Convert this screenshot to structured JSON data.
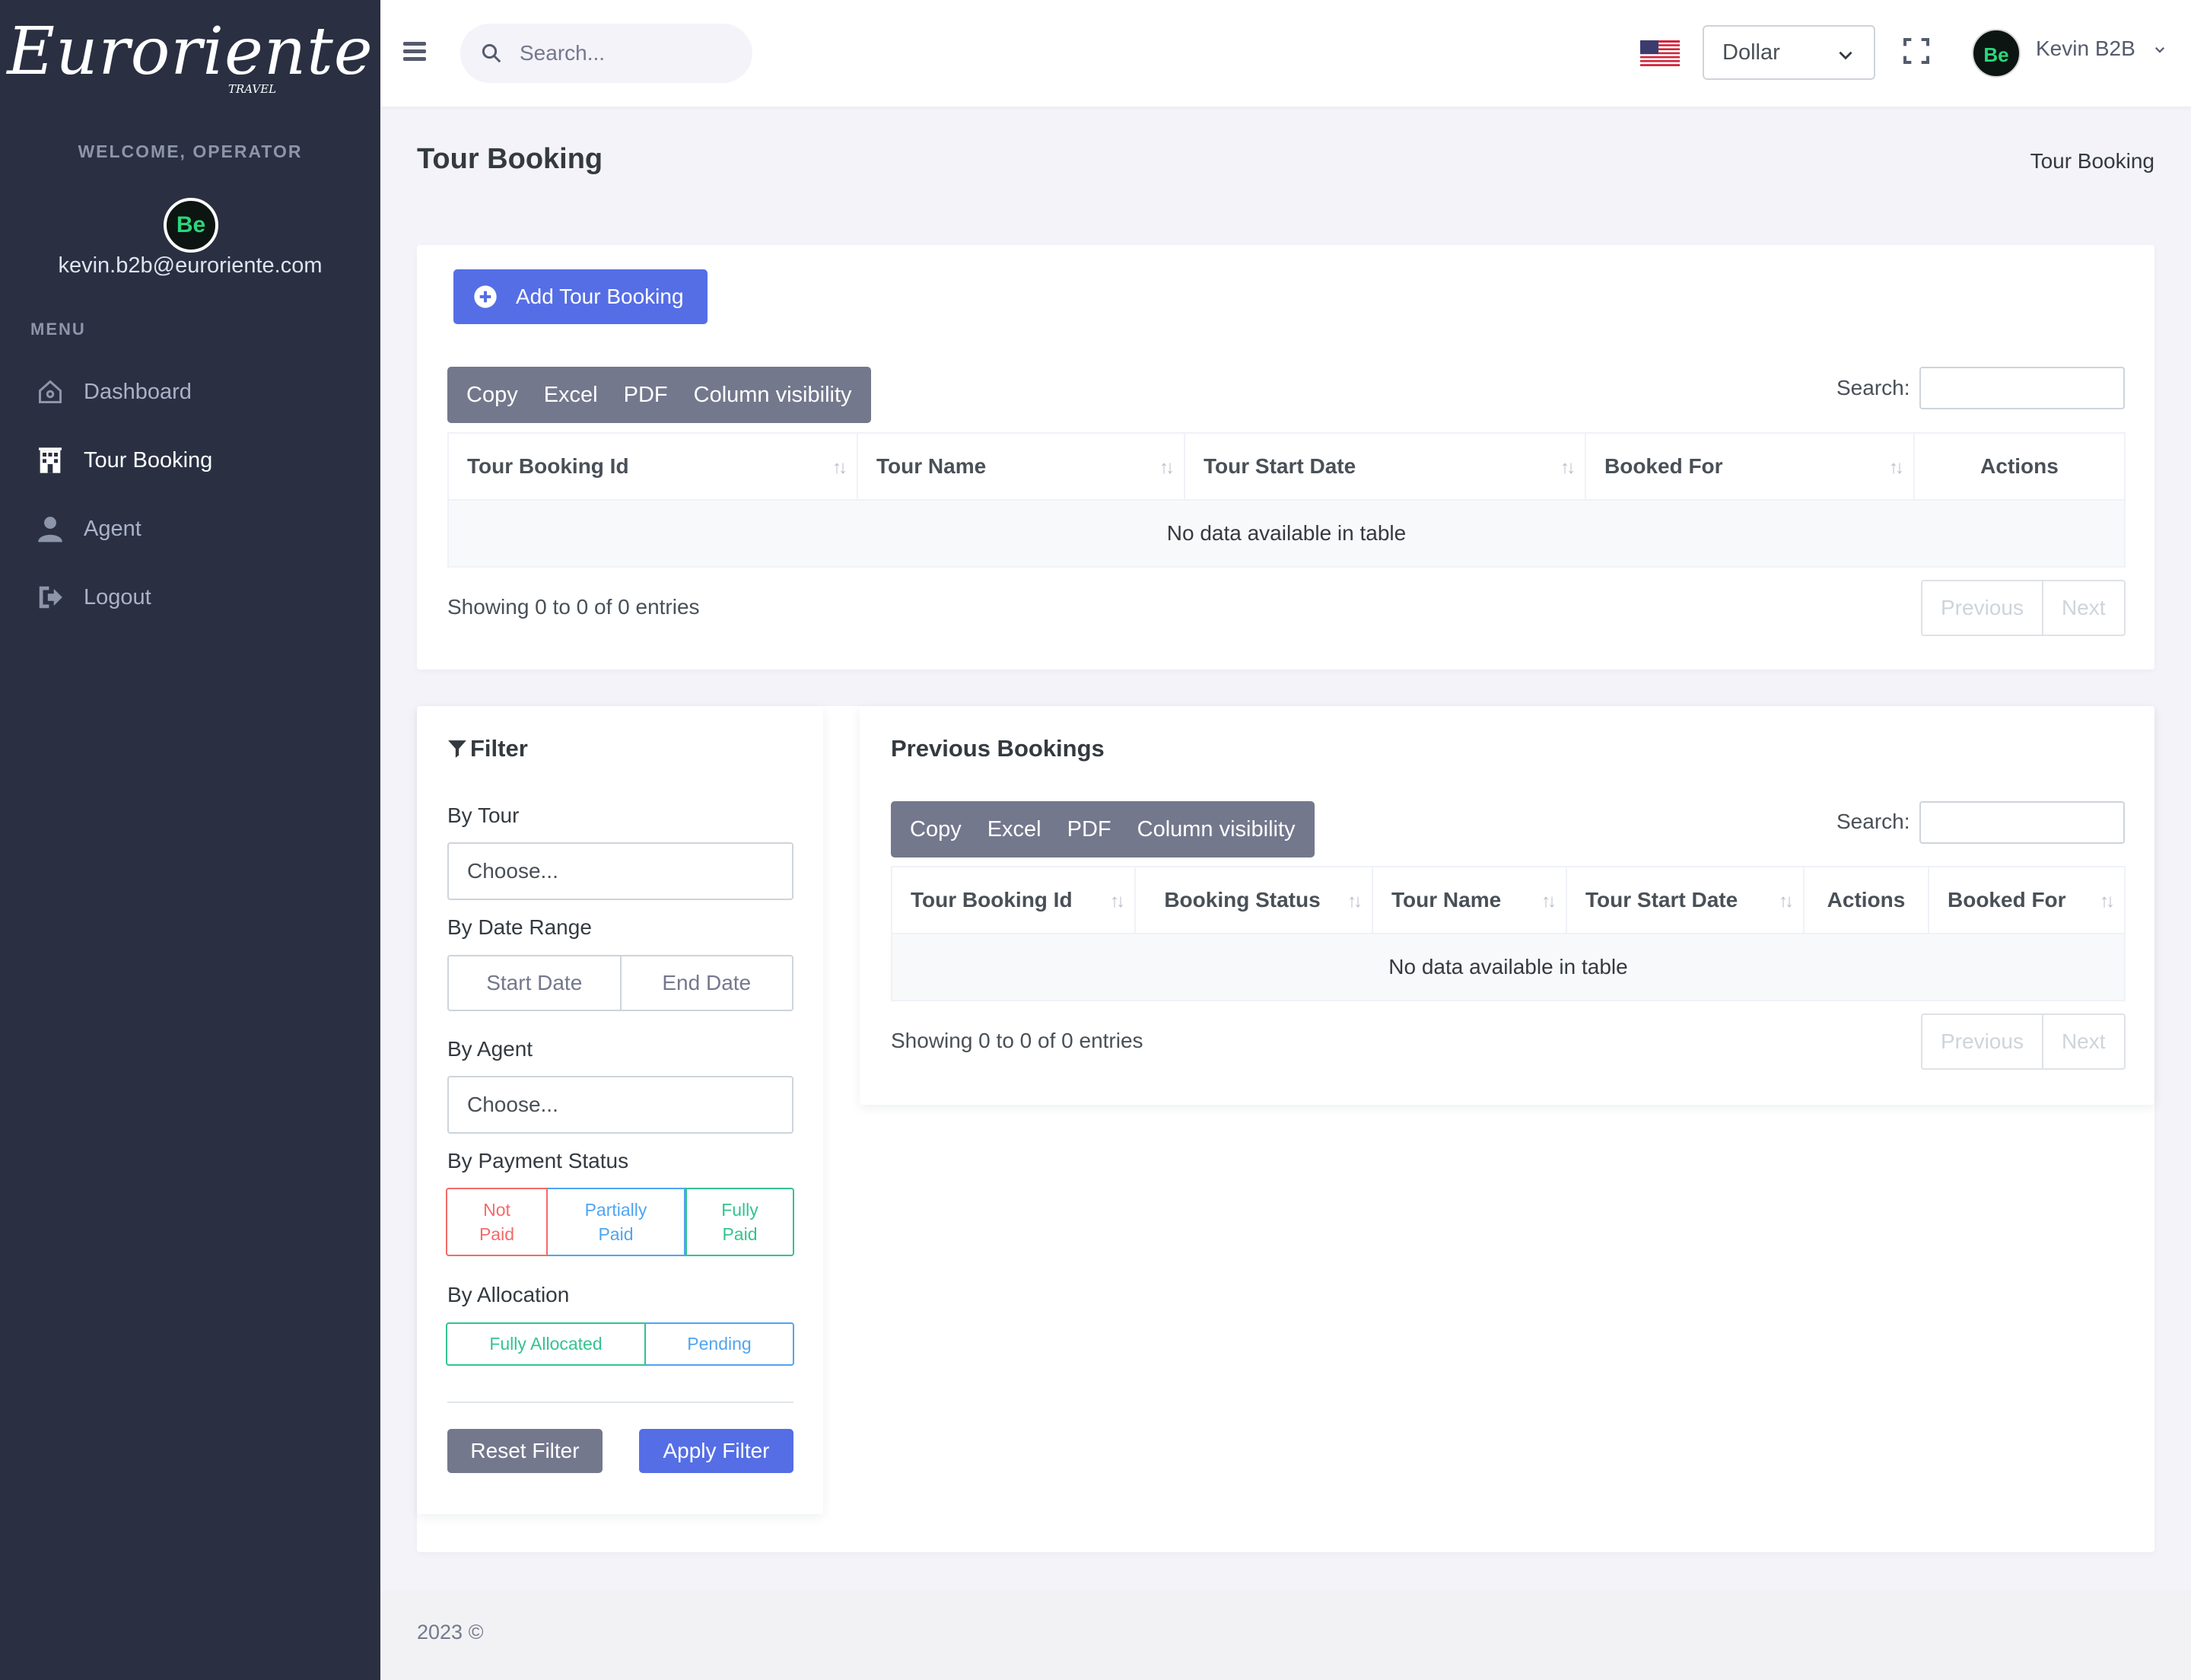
{
  "brand": {
    "logo": "Euroriente",
    "logo_sub": "TRAVEL"
  },
  "sidebar": {
    "welcome": "WELCOME, OPERATOR",
    "avatar_text": "Be",
    "email": "kevin.b2b@euroriente.com",
    "menu_title": "MENU",
    "items": [
      {
        "label": "Dashboard",
        "icon": "home-icon"
      },
      {
        "label": "Tour Booking",
        "icon": "building-icon"
      },
      {
        "label": "Agent",
        "icon": "user-icon"
      },
      {
        "label": "Logout",
        "icon": "logout-icon"
      }
    ]
  },
  "topbar": {
    "search_placeholder": "Search...",
    "currency": "Dollar",
    "user_name": "Kevin B2B",
    "avatar_text": "Be"
  },
  "page": {
    "title": "Tour Booking",
    "breadcrumb": "Tour Booking"
  },
  "bookings": {
    "add_label": "Add Tour Booking",
    "buttons": [
      "Copy",
      "Excel",
      "PDF",
      "Column visibility"
    ],
    "search_label": "Search:",
    "columns": [
      "Tour Booking Id",
      "Tour Name",
      "Tour Start Date",
      "Booked For",
      "Actions"
    ],
    "empty": "No data available in table",
    "showing": "Showing 0 to 0 of 0 entries",
    "prev": "Previous",
    "next": "Next"
  },
  "filter": {
    "title": "Filter",
    "by_tour": "By Tour",
    "tour_value": "Choose...",
    "by_date": "By Date Range",
    "start_date": "Start Date",
    "end_date": "End Date",
    "by_agent": "By Agent",
    "agent_value": "Choose...",
    "by_payment": "By Payment Status",
    "payment": {
      "not_paid": [
        "Not",
        "Paid"
      ],
      "partially_paid": [
        "Partially",
        "Paid"
      ],
      "fully_paid": [
        "Fully",
        "Paid"
      ]
    },
    "by_allocation": "By Allocation",
    "fully_allocated": "Fully Allocated",
    "pending": "Pending",
    "reset": "Reset Filter",
    "apply": "Apply Filter"
  },
  "previous": {
    "title": "Previous Bookings",
    "buttons": [
      "Copy",
      "Excel",
      "PDF",
      "Column visibility"
    ],
    "search_label": "Search:",
    "columns": [
      "Tour Booking Id",
      "Booking Status",
      "Tour Name",
      "Tour Start Date",
      "Actions",
      "Booked For"
    ],
    "empty": "No data available in table",
    "showing": "Showing 0 to 0 of 0 entries",
    "prev": "Previous",
    "next": "Next"
  },
  "footer": {
    "text": "2023 ©"
  },
  "colors": {
    "sidebar": "#2a3042",
    "primary": "#556ee6",
    "secondary": "#74788d",
    "danger": "#f46a6a",
    "info": "#50a5f1",
    "success": "#34c38f"
  }
}
